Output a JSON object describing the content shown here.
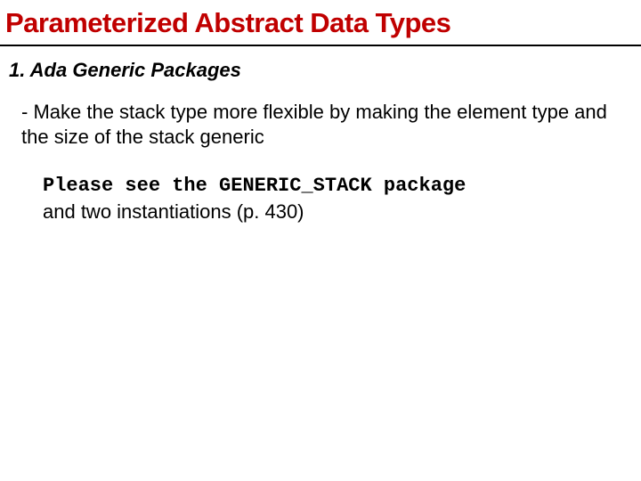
{
  "title": "Parameterized Abstract Data Types",
  "section": {
    "heading": "1. Ada Generic Packages",
    "bullet": "- Make the stack type more flexible by making the element type and the size of the stack generic",
    "note": {
      "mono_prefix": " Please see the ",
      "mono_code": "GENERIC_STACK",
      "mono_suffix": " package",
      "plain_line": "and two instantiations (p. 430)"
    }
  }
}
